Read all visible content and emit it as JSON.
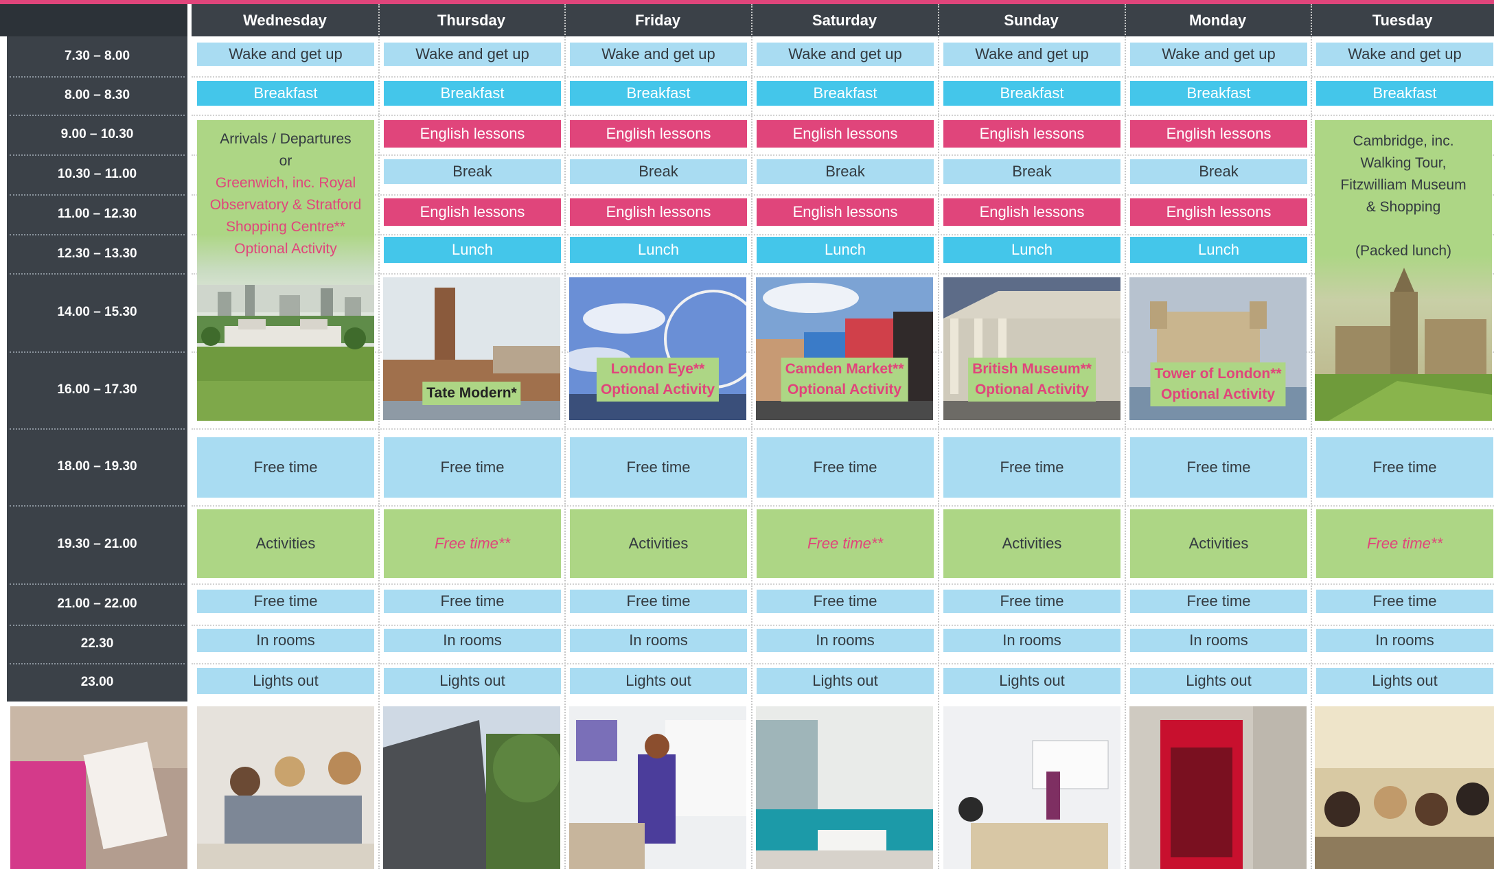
{
  "colors": {
    "accent_pink": "#e0457b",
    "light_blue": "#a9dcf2",
    "dark_blue": "#44c6ea",
    "green": "#add685",
    "slate": "#3b4148"
  },
  "days": [
    "Wednesday",
    "Thursday",
    "Friday",
    "Saturday",
    "Sunday",
    "Monday",
    "Tuesday"
  ],
  "times": [
    "7.30 – 8.00",
    "8.00 – 8.30",
    "9.00 – 10.30",
    "10.30 – 11.00",
    "11.00 – 12.30",
    "12.30 – 13.30",
    "14.00 – 15.30",
    "16.00 – 17.30",
    "18.00 – 19.30",
    "19.30 – 21.00",
    "21.00 – 22.00",
    "22.30",
    "23.00"
  ],
  "labels": {
    "wake": "Wake and get up",
    "breakfast": "Breakfast",
    "english": "English lessons",
    "break": "Break",
    "lunch": "Lunch",
    "free_time": "Free time",
    "activities": "Activities",
    "free_time_star": "Free time**",
    "in_rooms": "In rooms",
    "lights_out": "Lights out"
  },
  "wednesday": {
    "line1": "Arrivals / Departures",
    "line2": "or",
    "line3": "Greenwich, inc. Royal",
    "line4": "Observatory & Stratford",
    "line5": "Shopping Centre**",
    "line6": "Optional Activity"
  },
  "tuesday": {
    "line1": "Cambridge, inc.",
    "line2": "Walking Tour,",
    "line3": "Fitzwilliam Museum",
    "line4": "& Shopping",
    "line5": "(Packed lunch)"
  },
  "excursions": {
    "thursday": {
      "line1": "Tate Modern*"
    },
    "friday": {
      "line1": "London Eye**",
      "line2": "Optional Activity"
    },
    "saturday": {
      "line1": "Camden Market**",
      "line2": "Optional Activity"
    },
    "sunday": {
      "line1": "British Museum**",
      "line2": "Optional Activity"
    },
    "monday": {
      "line1": "Tower of London**",
      "line2": "Optional Activity"
    }
  },
  "photos": [
    "certificate-photo",
    "students-table-photo",
    "residence-building-photo",
    "classroom-whiteboard-photo",
    "lounge-sofa-photo",
    "lecture-room-photo",
    "telephone-box-photo",
    "students-group-photo"
  ]
}
